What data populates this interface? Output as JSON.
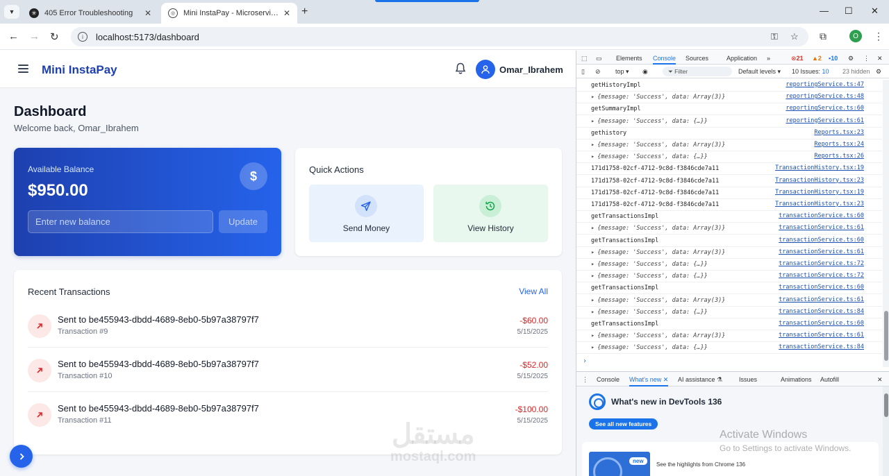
{
  "browser": {
    "tabs": [
      {
        "title": "405 Error Troubleshooting",
        "active": false
      },
      {
        "title": "Mini InstaPay - Microservice Ar",
        "active": true
      }
    ],
    "new_tab_symbol": "+",
    "url": "localhost:5173/dashboard",
    "profile_initial": "O",
    "accent_color": "#1a73e8"
  },
  "app": {
    "brand": "Mini InstaPay",
    "username": "Omar_Ibrahem",
    "page_title": "Dashboard",
    "welcome": "Welcome back, Omar_Ibrahem",
    "balance": {
      "label": "Available Balance",
      "amount": "$950.00",
      "currency_symbol": "$",
      "input_placeholder": "Enter new balance",
      "update_label": "Update"
    },
    "quick_actions": {
      "title": "Quick Actions",
      "items": [
        {
          "label": "Send Money",
          "icon": "send-icon"
        },
        {
          "label": "View History",
          "icon": "history-icon"
        }
      ]
    },
    "transactions": {
      "title": "Recent Transactions",
      "view_all": "View All",
      "items": [
        {
          "title": "Sent to be455943-dbdd-4689-8eb0-5b97a38797f7",
          "subtitle": "Transaction #9",
          "amount": "-$60.00",
          "date": "5/15/2025"
        },
        {
          "title": "Sent to be455943-dbdd-4689-8eb0-5b97a38797f7",
          "subtitle": "Transaction #10",
          "amount": "-$52.00",
          "date": "5/15/2025"
        },
        {
          "title": "Sent to be455943-dbdd-4689-8eb0-5b97a38797f7",
          "subtitle": "Transaction #11",
          "amount": "-$100.00",
          "date": "5/15/2025"
        }
      ]
    },
    "brand_color": "#1e40af",
    "debit_color": "#dc2626"
  },
  "watermark": {
    "arabic": "مستقل",
    "latin": "mostaql.com"
  },
  "devtools": {
    "tabs": [
      "Elements",
      "Console",
      "Sources",
      "Application"
    ],
    "active_tab": "Console",
    "errors": "21",
    "warnings": "2",
    "info": "10",
    "context": "top",
    "filter_placeholder": "Filter",
    "levels": "Default levels",
    "issues_label": "10 Issues:",
    "issues_count": "10",
    "hidden": "23 hidden",
    "console_lines": [
      {
        "msg": "getHistoryImpl",
        "src": "reportingService.ts:47",
        "obj": false
      },
      {
        "msg": "{message: 'Success', data: Array(3)}",
        "src": "reportingService.ts:48",
        "obj": true
      },
      {
        "msg": "getSummaryImpl",
        "src": "reportingService.ts:60",
        "obj": false
      },
      {
        "msg": "{message: 'Success', data: {…}}",
        "src": "reportingService.ts:61",
        "obj": true
      },
      {
        "msg": "gethistory",
        "src": "Reports.tsx:23",
        "obj": false
      },
      {
        "msg": "{message: 'Success', data: Array(3)}",
        "src": "Reports.tsx:24",
        "obj": true
      },
      {
        "msg": "{message: 'Success', data: {…}}",
        "src": "Reports.tsx:26",
        "obj": true
      },
      {
        "msg": "171d1758-02cf-4712-9c8d-f3846cde7a11",
        "src": "TransactionHistory.tsx:19",
        "obj": false
      },
      {
        "msg": "171d1758-02cf-4712-9c8d-f3846cde7a11",
        "src": "TransactionHistory.tsx:23",
        "obj": false
      },
      {
        "msg": "171d1758-02cf-4712-9c8d-f3846cde7a11",
        "src": "TransactionHistory.tsx:19",
        "obj": false
      },
      {
        "msg": "171d1758-02cf-4712-9c8d-f3846cde7a11",
        "src": "TransactionHistory.tsx:23",
        "obj": false
      },
      {
        "msg": "getTransactionsImpl",
        "src": "transactionService.ts:60",
        "obj": false
      },
      {
        "msg": "{message: 'Success', data: Array(3)}",
        "src": "transactionService.ts:61",
        "obj": true
      },
      {
        "msg": "getTransactionsImpl",
        "src": "transactionService.ts:60",
        "obj": false
      },
      {
        "msg": "{message: 'Success', data: Array(3)}",
        "src": "transactionService.ts:61",
        "obj": true
      },
      {
        "msg": "{message: 'Success', data: {…}}",
        "src": "transactionService.ts:72",
        "obj": true
      },
      {
        "msg": "{message: 'Success', data: {…}}",
        "src": "transactionService.ts:72",
        "obj": true
      },
      {
        "msg": "getTransactionsImpl",
        "src": "transactionService.ts:60",
        "obj": false
      },
      {
        "msg": "{message: 'Success', data: Array(3)}",
        "src": "transactionService.ts:61",
        "obj": true
      },
      {
        "msg": "{message: 'Success', data: {…}}",
        "src": "transactionService.ts:84",
        "obj": true
      },
      {
        "msg": "getTransactionsImpl",
        "src": "transactionService.ts:60",
        "obj": false
      },
      {
        "msg": "{message: 'Success', data: Array(3)}",
        "src": "transactionService.ts:61",
        "obj": true
      },
      {
        "msg": "{message: 'Success', data: {…}}",
        "src": "transactionService.ts:84",
        "obj": true
      }
    ],
    "prompt": "›",
    "drawer_tabs": [
      "Console",
      "What's new",
      "AI assistance",
      "Issues",
      "Animations",
      "Autofill"
    ],
    "drawer_active": "What's new",
    "whats_new_title": "What's new in DevTools 136",
    "see_all": "See all new features",
    "promo_badge": "new",
    "promo_text": "See the highlights from Chrome 136"
  },
  "os_overlay": {
    "line1": "Activate Windows",
    "line2": "Go to Settings to activate Windows."
  }
}
